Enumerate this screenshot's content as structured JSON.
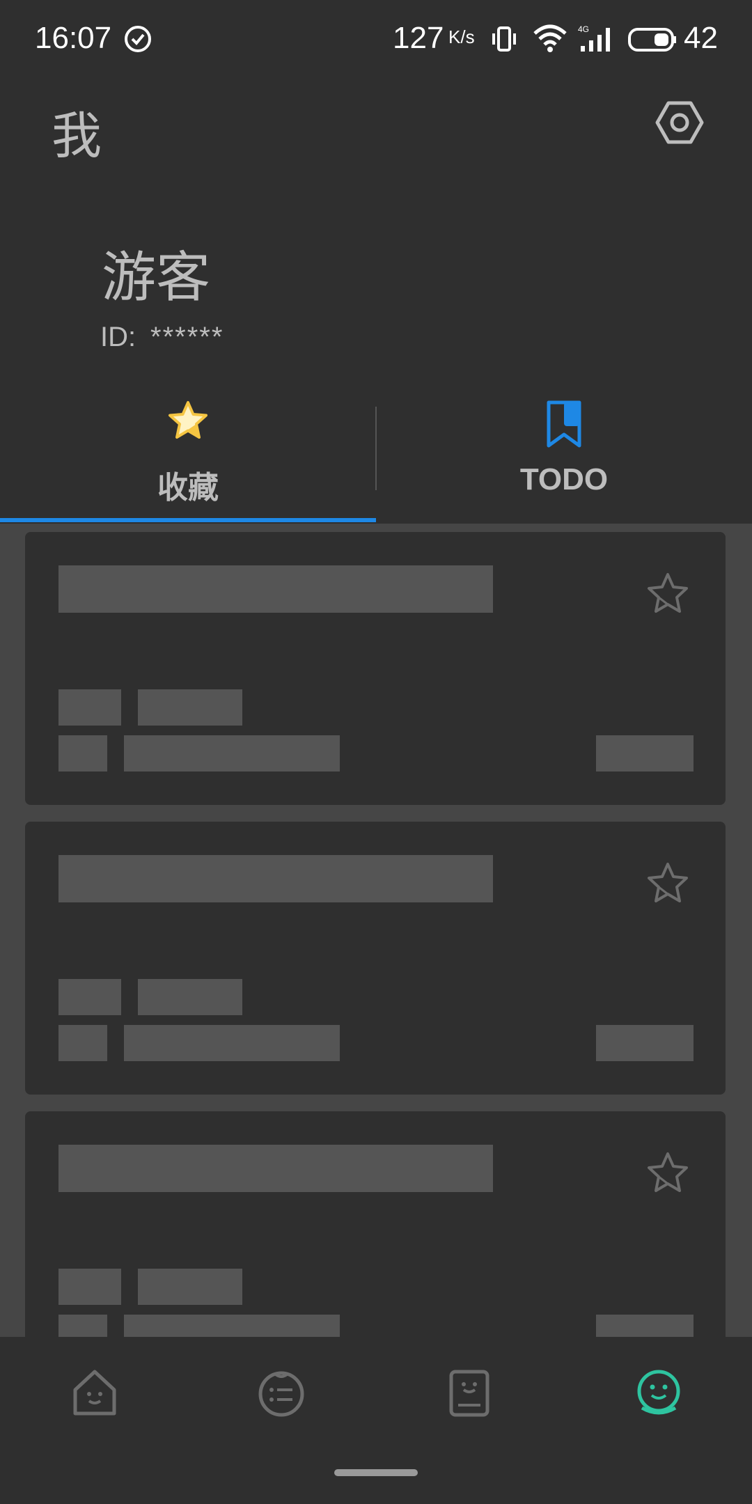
{
  "status_bar": {
    "time": "16:07",
    "net_speed": "127",
    "net_speed_unit": "K/s",
    "battery": "42",
    "icons": [
      "check-circle-icon",
      "vibrate-icon",
      "wifi-icon",
      "signal-4g-icon",
      "battery-icon"
    ]
  },
  "header": {
    "title": "我",
    "settings_icon": "settings-hexagon-icon"
  },
  "profile": {
    "name": "游客",
    "id_label": "ID:",
    "id_value": "******"
  },
  "tabs": [
    {
      "label": "收藏",
      "icon": "star-icon",
      "active": true
    },
    {
      "label": "TODO",
      "icon": "bookmark-icon",
      "active": false
    }
  ],
  "cards": [
    {
      "state": "loading-placeholder",
      "favorite": false
    },
    {
      "state": "loading-placeholder",
      "favorite": false
    },
    {
      "state": "loading-placeholder",
      "favorite": false
    }
  ],
  "bottom_nav": [
    {
      "name": "home",
      "icon": "home-icon",
      "active": false
    },
    {
      "name": "list",
      "icon": "list-icon",
      "active": false
    },
    {
      "name": "todo",
      "icon": "clipboard-icon",
      "active": false
    },
    {
      "name": "me",
      "icon": "smile-user-icon",
      "active": true
    }
  ],
  "colors": {
    "background": "#2f2f2f",
    "accent_blue": "#1e88e5",
    "active_nav": "#2ec4a0",
    "star_yellow": "#f5c542",
    "placeholder": "#555555"
  }
}
